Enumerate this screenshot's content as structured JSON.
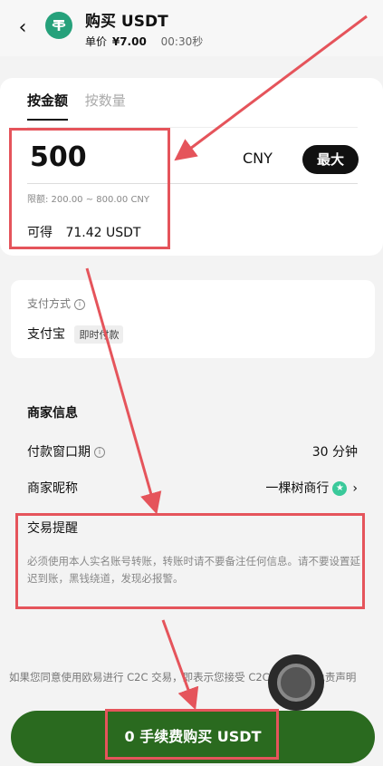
{
  "header": {
    "title": "购买 USDT",
    "price_label": "单价",
    "price_value": "¥7.00",
    "timer": "00:30秒",
    "coin_symbol": "₮"
  },
  "amount_card": {
    "tabs": [
      {
        "label": "按金额",
        "active": true
      },
      {
        "label": "按数量",
        "active": false
      }
    ],
    "amount_value": "500",
    "currency": "CNY",
    "max_label": "最大",
    "limit_text": "限额: 200.00 ~ 800.00 CNY",
    "receive_label": "可得",
    "receive_value": "71.42 USDT"
  },
  "payment": {
    "label": "支付方式",
    "method": "支付宝",
    "tag": "即时付款"
  },
  "merchant": {
    "title": "商家信息",
    "window_label": "付款窗口期",
    "window_value": "30 分钟",
    "nickname_label": "商家昵称",
    "nickname_value": "一棵树商行",
    "reminder_title": "交易提醒",
    "reminder_text": "必须使用本人实名账号转账，转账时请不要备注任何信息。请不要设置延迟到账，黑钱绕道，发现必报警。"
  },
  "disclaimer": "如果您同意使用欧易进行 C2C 交易，即表示您接受 C2C 交易法律免责声明",
  "buy_button": {
    "label": "0 手续费购买 USDT"
  },
  "colors": {
    "buy_button": "#2a6a1f",
    "annotation": "#e5545b",
    "tether": "#26a17b"
  },
  "icons": {
    "back": "chevron-left-icon",
    "coin": "tether-icon",
    "info": "info-icon",
    "verified": "verified-badge-icon",
    "chevron": "chevron-right-icon"
  }
}
